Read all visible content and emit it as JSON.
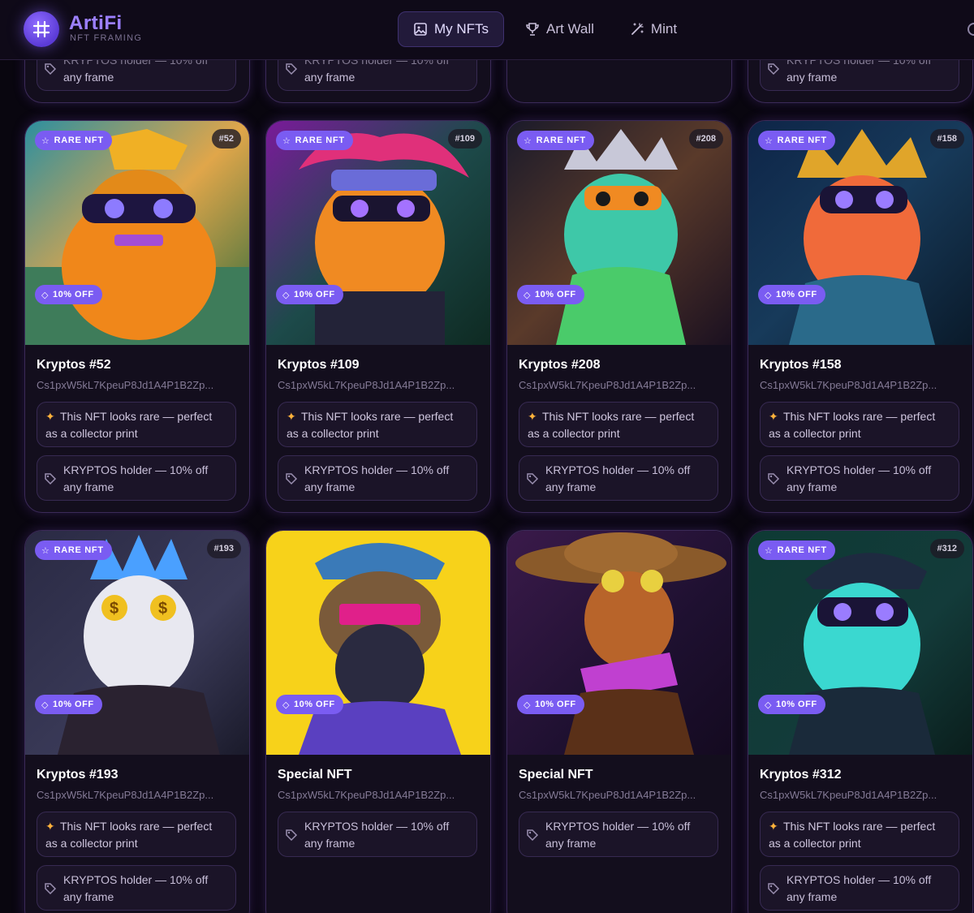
{
  "app": {
    "brand": "ArtiFi",
    "brand_sub": "NFT FRAMING"
  },
  "nav": {
    "items": [
      {
        "label": "My NFTs",
        "icon": "image-icon",
        "active": true
      },
      {
        "label": "Art Wall",
        "icon": "trophy-icon",
        "active": false
      },
      {
        "label": "Mint",
        "icon": "magic-wand-icon",
        "active": false
      }
    ]
  },
  "common": {
    "rare_badge": "RARE NFT",
    "discount_badge": "10% OFF",
    "rare_note_line1": "This NFT looks rare — perfect",
    "rare_note_line2": "as a collector print",
    "holder_line1": "KRYPTOS holder — 10% off",
    "holder_line2": "any frame",
    "address": "Cs1pxW5kL7KpeuP8Jd1A4P1B2Zp..."
  },
  "cards": [
    {
      "title": "Kryptos #52",
      "num": "#52",
      "rare": true
    },
    {
      "title": "Kryptos #109",
      "num": "#109",
      "rare": true
    },
    {
      "title": "Kryptos #208",
      "num": "#208",
      "rare": true
    },
    {
      "title": "Kryptos #158",
      "num": "#158",
      "rare": true
    },
    {
      "title": "Kryptos #193",
      "num": "#193",
      "rare": true
    },
    {
      "title": "Special NFT",
      "num": "",
      "rare": false
    },
    {
      "title": "Special NFT",
      "num": "",
      "rare": false
    },
    {
      "title": "Kryptos #312",
      "num": "#312",
      "rare": true
    }
  ],
  "colors": {
    "accent": "#7a5cf2",
    "background": "#09060f",
    "card": "#130e1d"
  }
}
